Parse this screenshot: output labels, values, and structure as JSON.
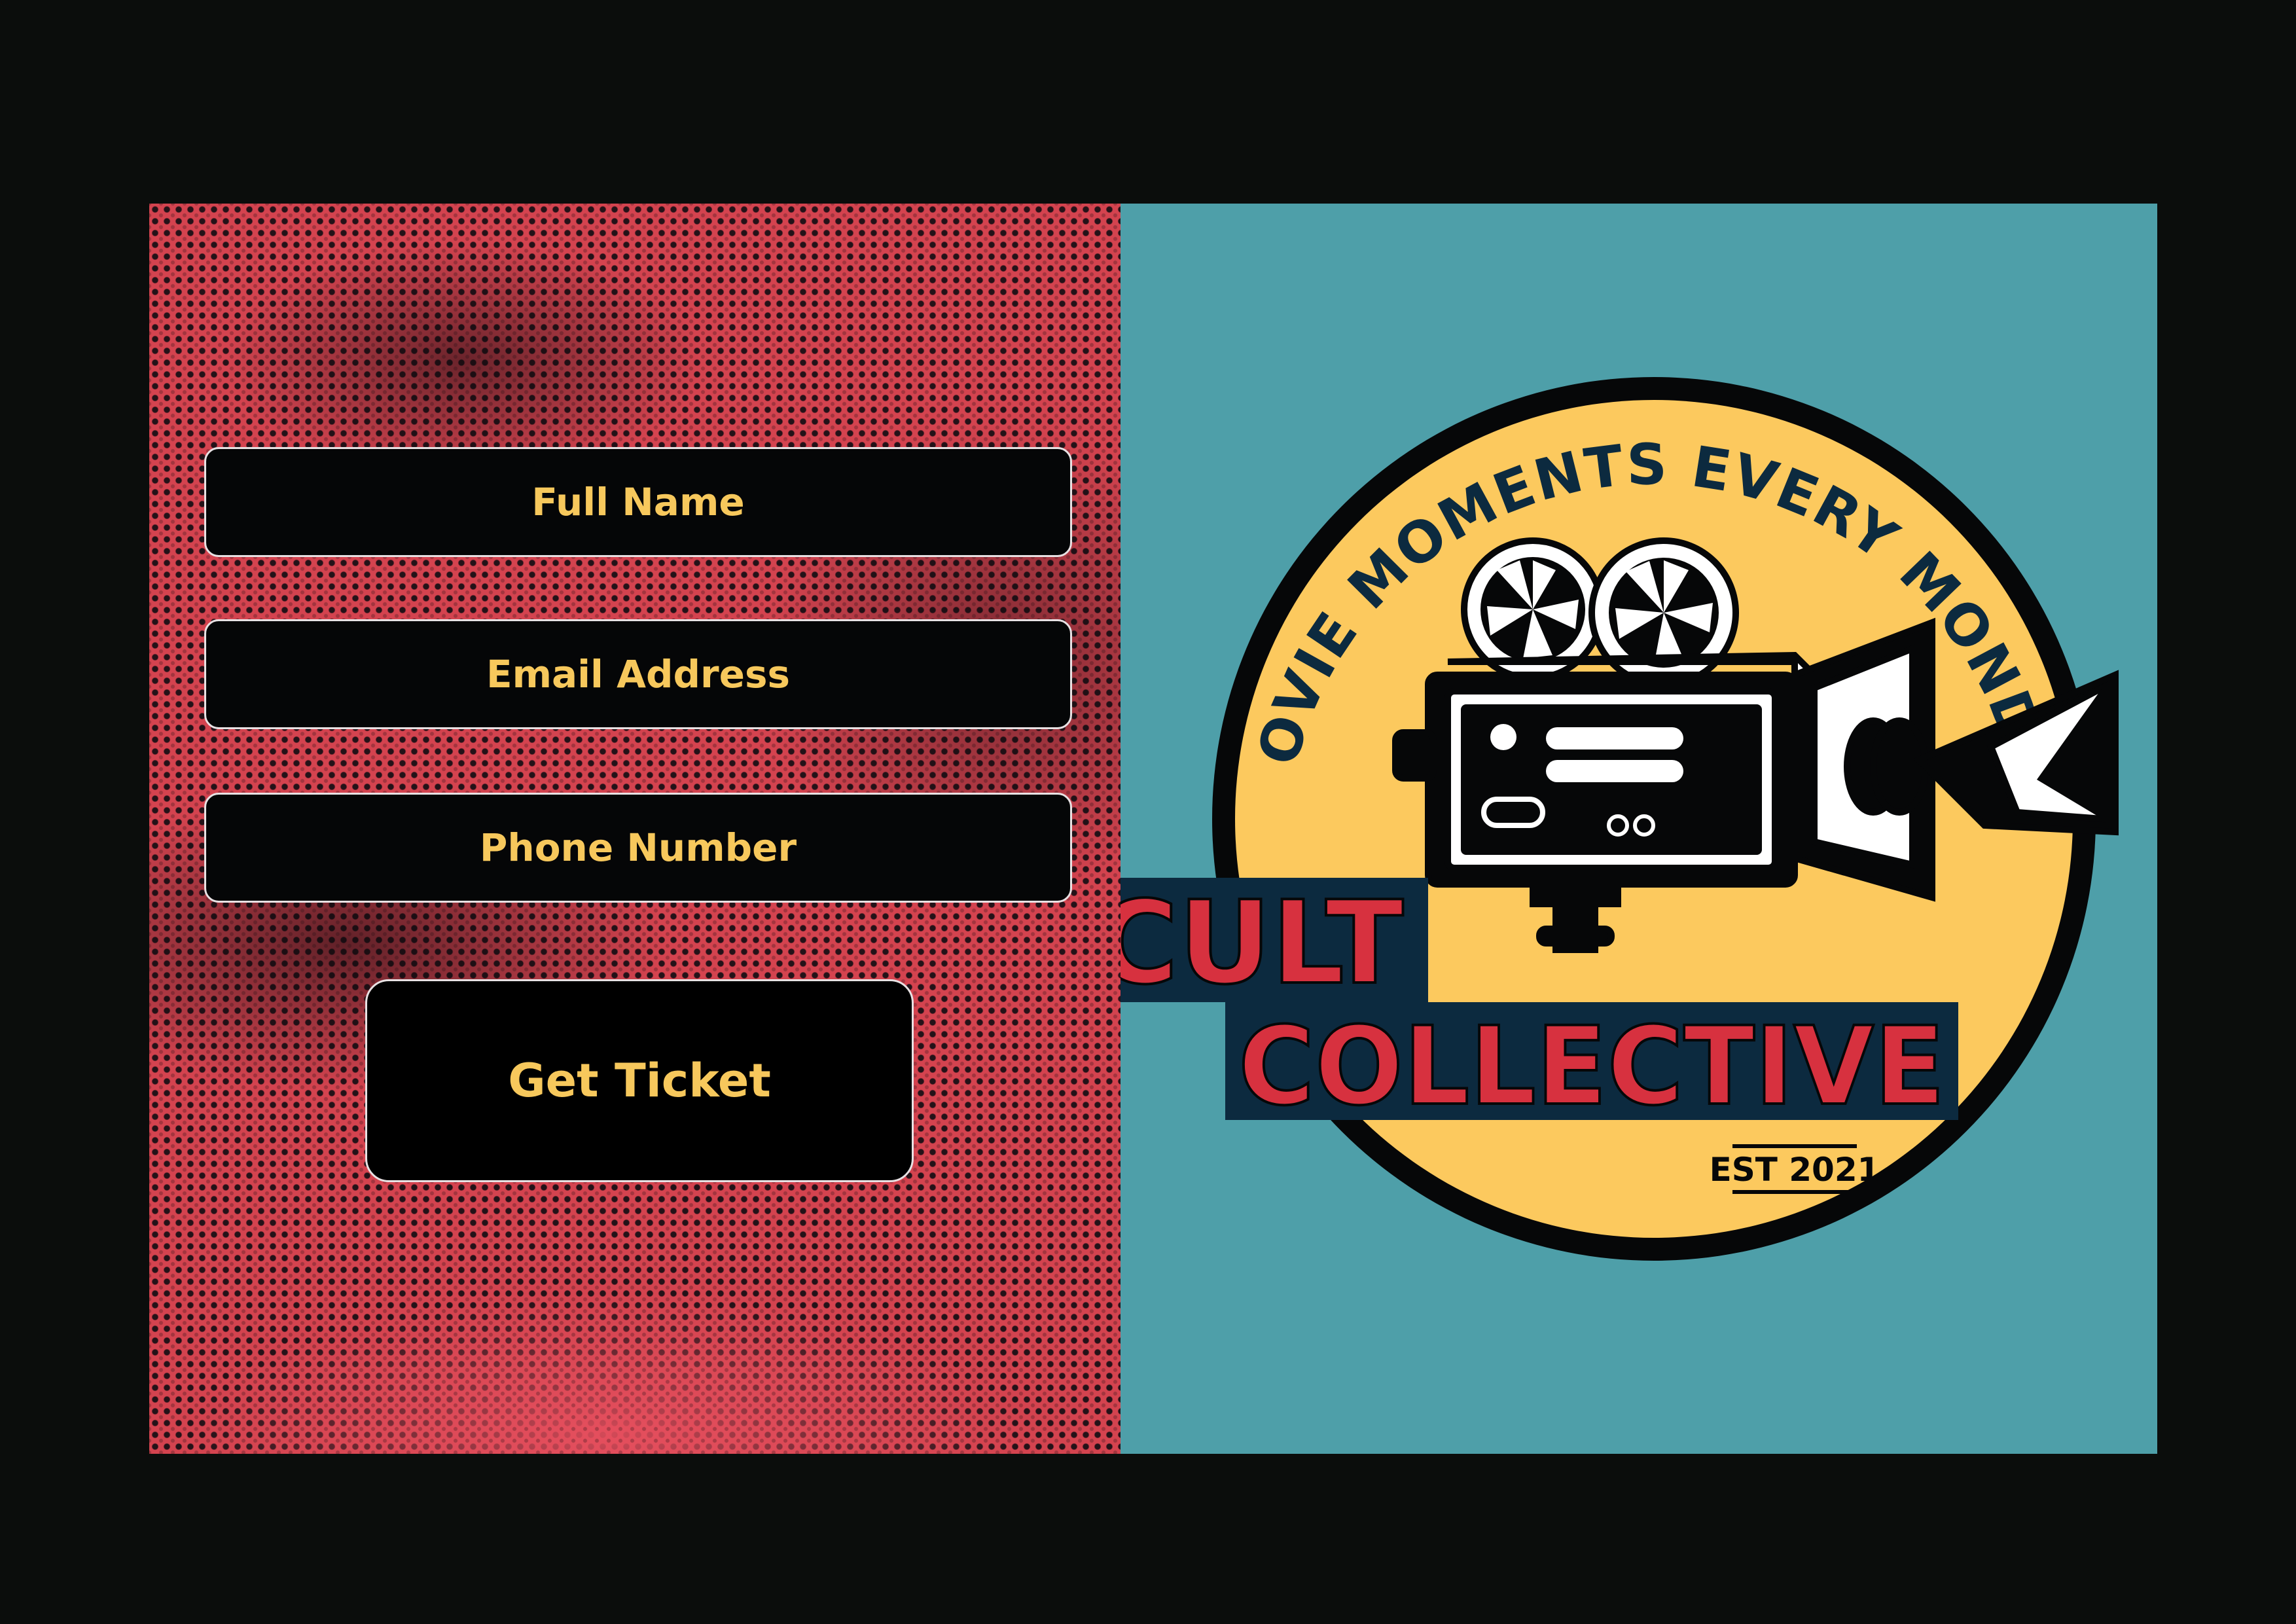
{
  "form": {
    "full_name_placeholder": "Full Name",
    "email_placeholder": "Email Address",
    "phone_placeholder": "Phone Number",
    "submit_label": "Get Ticket"
  },
  "logo": {
    "tagline": "MOVIE MOMENTS EVERY MONDAY",
    "name_line1": "CULT",
    "name_line2": "COLLECTIVE",
    "established": "EST 2021",
    "icon": "movie-camera-icon"
  },
  "colors": {
    "page_background": "#0b0d0c",
    "left_panel": "#d4434f",
    "right_panel": "#4e9fa9",
    "field_background": "#050607",
    "field_text": "#f7c85c",
    "logo_circle": "#fcc95e",
    "logo_banner": "#0c2a3f",
    "logo_red": "#d7313f"
  }
}
